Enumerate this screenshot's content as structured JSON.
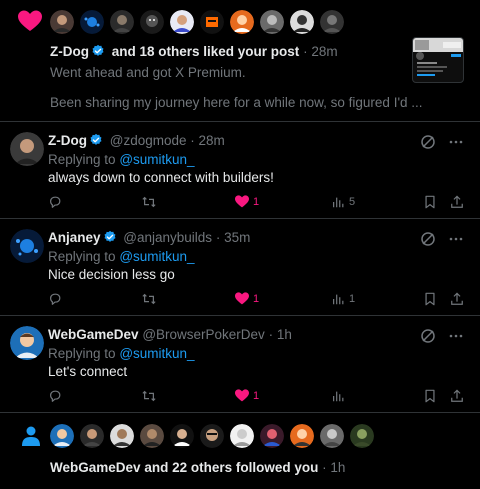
{
  "likes_notification": {
    "avatars": [
      "avatar-1",
      "avatar-2",
      "avatar-3",
      "avatar-4",
      "avatar-5",
      "avatar-6",
      "avatar-7",
      "avatar-8",
      "avatar-9",
      "avatar-10"
    ],
    "actor": "Z-Dog",
    "summary": "and 18 others liked your post",
    "separator": "·",
    "time": "28m",
    "post_line1": "Went ahead and got X Premium.",
    "post_line2": "Been sharing my journey here for a while now, so figured I'd ..."
  },
  "replies": [
    {
      "name": "Z-Dog",
      "handle": "@zdogmode",
      "separator": "·",
      "time": "28m",
      "replying_prefix": "Replying to",
      "replying_handle": "@sumitkun_",
      "text": "always down to connect with builders!",
      "likes": "1",
      "views": "5",
      "avatar_color": "#3a3a3a"
    },
    {
      "name": "Anjaney",
      "handle": "@anjanybuilds",
      "separator": "·",
      "time": "35m",
      "replying_prefix": "Replying to",
      "replying_handle": "@sumitkun_",
      "text": "Nice decision less go",
      "likes": "1",
      "views": "1",
      "avatar_color": "#0b2a4a"
    },
    {
      "name": "WebGameDev",
      "handle": "@BrowserPokerDev",
      "separator": "·",
      "time": "1h",
      "replying_prefix": "Replying to",
      "replying_handle": "@sumitkun_",
      "text": "Let's connect",
      "likes": "1",
      "views": "",
      "avatar_color": "#1d6fb8"
    }
  ],
  "follow_notification": {
    "avatars": [
      "avatar-1",
      "avatar-2",
      "avatar-3",
      "avatar-4",
      "avatar-5",
      "avatar-6",
      "avatar-7",
      "avatar-8",
      "avatar-9",
      "avatar-10"
    ],
    "actor": "WebGameDev",
    "summary": "and 22 others followed you",
    "separator": "·",
    "time": "1h"
  },
  "colors": {
    "background": "#000000",
    "text": "#e7e9ea",
    "muted": "#71767b",
    "link": "#1d9bf0",
    "like": "#f91880",
    "divider": "#2f3336"
  }
}
